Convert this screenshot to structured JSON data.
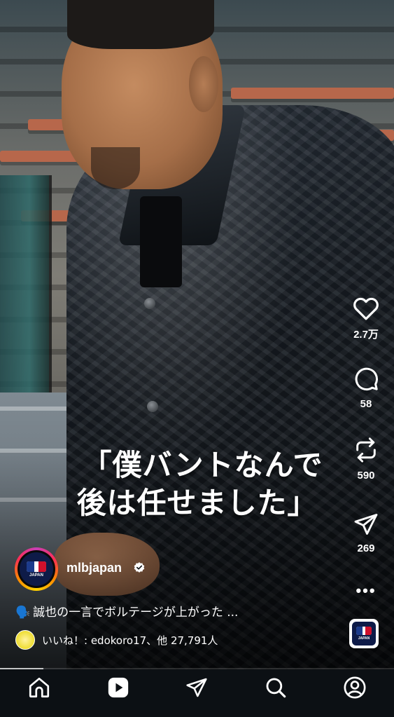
{
  "reel": {
    "subtitle_line1": "「僕バントなんで",
    "subtitle_line2": "後は任せました」",
    "progress_fraction": 0.11
  },
  "actions": {
    "like_count": "2.7万",
    "comment_count": "58",
    "repost_count": "590",
    "share_count": "269",
    "more_label": "•••"
  },
  "account": {
    "username": "mlbjapan",
    "avatar_text": "JAPAN",
    "verified_icon": "verified-badge-icon"
  },
  "caption": {
    "emoji": "🗣️",
    "text": "誠也の一言でボルテージが上がった ..."
  },
  "likes": {
    "text": "いいね！: edokoro17、他 27,791人"
  },
  "audio": {
    "label": "JAPAN"
  },
  "nav": {
    "items": [
      "home-icon",
      "reels-icon",
      "send-icon",
      "search-icon",
      "profile-icon"
    ],
    "active": "reels-icon"
  },
  "colors": {
    "nav_background": "#0c1014",
    "text": "#ffffff",
    "mlb_navy": "#0e1b48",
    "mlb_red": "#d0102b",
    "mlb_blue": "#1c3b8c"
  }
}
